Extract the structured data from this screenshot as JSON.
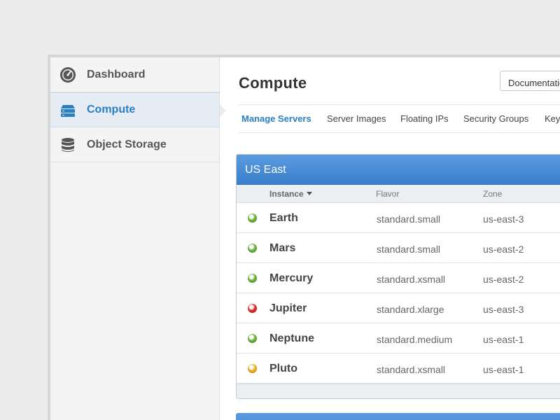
{
  "sidebar": {
    "items": [
      {
        "label": "Dashboard",
        "icon": "speedometer-icon",
        "active": false
      },
      {
        "label": "Compute",
        "icon": "server-stack-icon",
        "active": true
      },
      {
        "label": "Object Storage",
        "icon": "database-icon",
        "active": false
      }
    ]
  },
  "header": {
    "title": "Compute",
    "documentation_label": "Documentation"
  },
  "tabs": [
    {
      "label": "Manage Servers",
      "active": true
    },
    {
      "label": "Server Images",
      "active": false
    },
    {
      "label": "Floating IPs",
      "active": false
    },
    {
      "label": "Security Groups",
      "active": false
    },
    {
      "label": "Key",
      "active": false
    }
  ],
  "region": {
    "title": "US East",
    "columns": {
      "instance": "Instance",
      "flavor": "Flavor",
      "zone": "Zone"
    },
    "rows": [
      {
        "status": "green",
        "name": "Earth",
        "flavor": "standard.small",
        "zone": "us-east-3"
      },
      {
        "status": "green",
        "name": "Mars",
        "flavor": "standard.small",
        "zone": "us-east-2"
      },
      {
        "status": "green",
        "name": "Mercury",
        "flavor": "standard.xsmall",
        "zone": "us-east-2"
      },
      {
        "status": "red",
        "name": "Jupiter",
        "flavor": "standard.xlarge",
        "zone": "us-east-3"
      },
      {
        "status": "green",
        "name": "Neptune",
        "flavor": "standard.medium",
        "zone": "us-east-1"
      },
      {
        "status": "yellow",
        "name": "Pluto",
        "flavor": "standard.xsmall",
        "zone": "us-east-1"
      }
    ]
  },
  "colors": {
    "accent": "#2a7ec2",
    "status_green": "#6cb23a",
    "status_red": "#d9302c",
    "status_yellow": "#f0b020"
  }
}
